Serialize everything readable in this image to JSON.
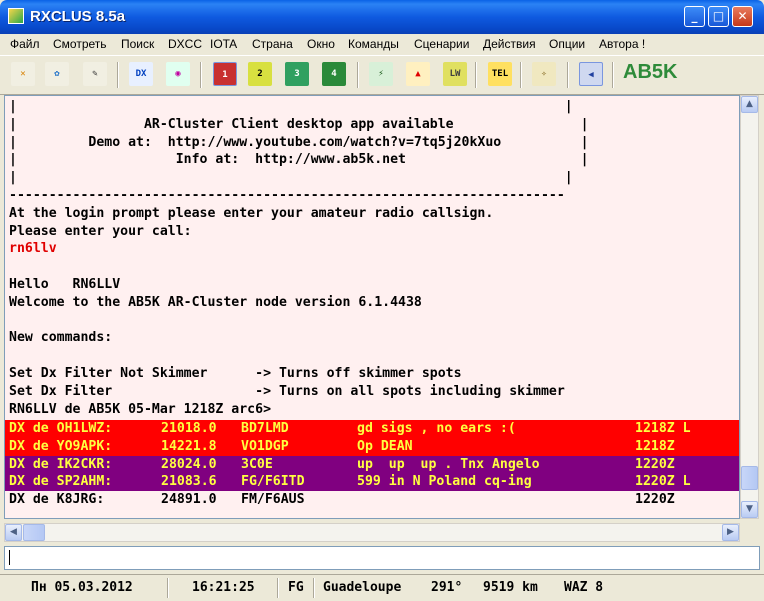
{
  "window": {
    "title": "RXCLUS 8.5a"
  },
  "menu": [
    "Файл",
    "Смотреть",
    "Поиск",
    "DXCC",
    "IOTA",
    "Страна",
    "Окно",
    "Команды",
    "Сценарии",
    "Действия",
    "Опции",
    "Автора !"
  ],
  "toolbar": {
    "icons": [
      {
        "name": "antenna-tool-icon",
        "glyph": "✕"
      },
      {
        "name": "map-tool-icon",
        "glyph": "✿"
      },
      {
        "name": "brush-tool-icon",
        "glyph": "✎"
      },
      {
        "name": "dx-eye-icon",
        "glyph": "DX"
      },
      {
        "name": "search-globe-icon",
        "glyph": "◉"
      },
      {
        "name": "window-1-icon",
        "glyph": "1"
      },
      {
        "name": "window-2-icon",
        "glyph": "2"
      },
      {
        "name": "window-3-icon",
        "glyph": "3"
      },
      {
        "name": "window-4-icon",
        "glyph": "4"
      },
      {
        "name": "tower-icon",
        "glyph": "⚡"
      },
      {
        "name": "bell-icon",
        "glyph": "▲"
      },
      {
        "name": "lotw-icon",
        "glyph": "LW"
      },
      {
        "name": "telnet-icon",
        "glyph": "TEL"
      },
      {
        "name": "clean-icon",
        "glyph": "✧"
      },
      {
        "name": "speaker-icon",
        "glyph": "◀"
      }
    ],
    "callsign": "AB5K"
  },
  "terminal": {
    "lines": [
      {
        "text": "|                                                                     |",
        "style": "normal"
      },
      {
        "text": "|                AR-Cluster Client desktop app available                |",
        "style": "normal"
      },
      {
        "text": "|         Demo at:  http://www.youtube.com/watch?v=7tq5j20kXuo          |",
        "style": "normal"
      },
      {
        "text": "|                    Info at:  http://www.ab5k.net                      |",
        "style": "normal"
      },
      {
        "text": "|                                                                     |",
        "style": "normal"
      },
      {
        "text": "----------------------------------------------------------------------",
        "style": "normal"
      },
      {
        "text": "At the login prompt please enter your amateur radio callsign.",
        "style": "normal"
      },
      {
        "text": "Please enter your call:",
        "style": "normal"
      },
      {
        "text": "rn6llv",
        "style": "red"
      },
      {
        "text": "",
        "style": "normal"
      },
      {
        "text": "Hello   RN6LLV",
        "style": "normal"
      },
      {
        "text": "Welcome to the AB5K AR-Cluster node version 6.1.4438",
        "style": "normal"
      },
      {
        "text": "",
        "style": "normal"
      },
      {
        "text": "New commands:",
        "style": "normal"
      },
      {
        "text": "",
        "style": "normal"
      },
      {
        "text": "Set Dx Filter Not Skimmer      -> Turns off skimmer spots",
        "style": "normal"
      },
      {
        "text": "Set Dx Filter                  -> Turns on all spots including skimmer",
        "style": "normal"
      },
      {
        "text": "RN6LLV de AB5K 05-Mar 1218Z arc6>",
        "style": "normal"
      }
    ],
    "spots": [
      {
        "spotter": "DX de OH1LWZ:",
        "freq": "21018.0",
        "dx": "BD7LMD",
        "comment": "gd sigs , no ears :(",
        "time": "1218Z L",
        "bg": "red"
      },
      {
        "spotter": "DX de YO9APK:",
        "freq": "14221.8",
        "dx": "VO1DGP",
        "comment": "Op DEAN",
        "time": "1218Z",
        "bg": "red"
      },
      {
        "spotter": "DX de IK2CKR:",
        "freq": "28024.0",
        "dx": "3C0E",
        "comment": "up  up  up . Tnx Angelo",
        "time": "1220Z",
        "bg": "purple"
      },
      {
        "spotter": "DX de SP2AHM:",
        "freq": "21083.6",
        "dx": "FG/F6ITD",
        "comment": "599 in N Poland cq-ing",
        "time": "1220Z L",
        "bg": "purple"
      },
      {
        "spotter": "DX de K8JRG:",
        "freq": "24891.0",
        "dx": "FM/F6AUS",
        "comment": "",
        "time": "1220Z",
        "bg": "plain"
      }
    ]
  },
  "input": {
    "value": ""
  },
  "status": {
    "date": "Пн 05.03.2012",
    "time": "16:21:25",
    "prefix": "FG",
    "country": "Guadeloupe",
    "bearing": "291°",
    "distance": "9519 km",
    "waz": "WAZ 8"
  },
  "colors": {
    "spot_red": "#ff0000",
    "spot_purple": "#800080",
    "spot_text": "#ffff40",
    "callsign": "#2e8b3a",
    "terminal_bg": "#fff0f0"
  }
}
